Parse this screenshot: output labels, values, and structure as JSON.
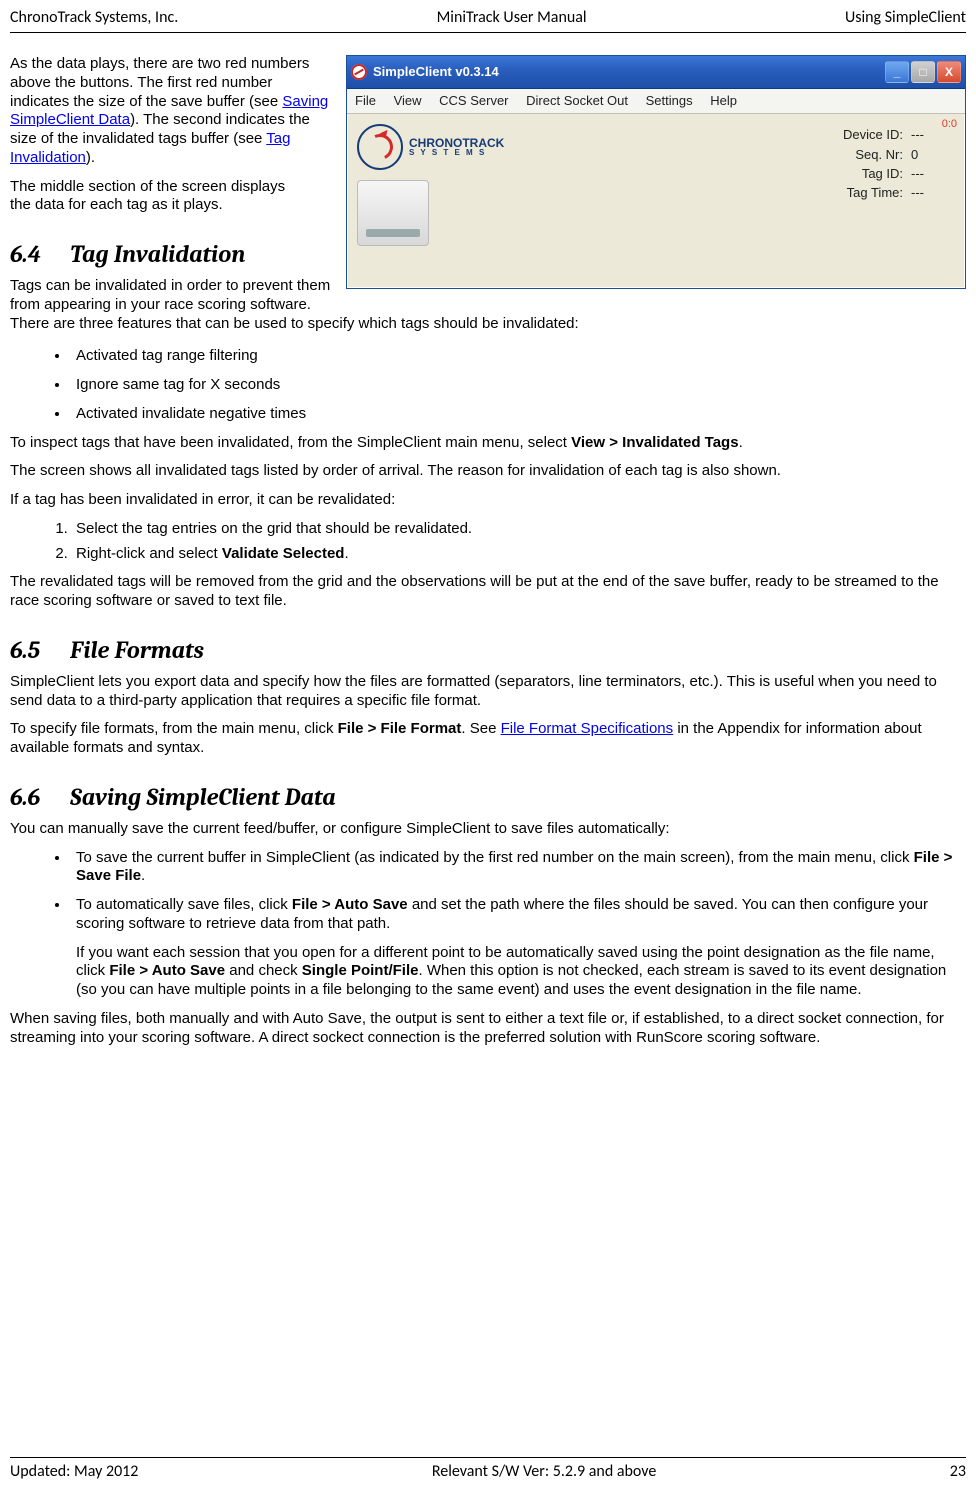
{
  "header": {
    "left": "ChronoTrack Systems, Inc.",
    "center": "MiniTrack User Manual",
    "right": "Using SimpleClient"
  },
  "footer": {
    "left": "Updated: May 2012",
    "center": "Relevant S/W Ver: 5.2.9 and above",
    "right": "23"
  },
  "intro": {
    "p1a": "As the data plays, there are two red numbers above the buttons.  The first red number indicates the size of the save buffer (see ",
    "link1": "Saving SimpleClient Data",
    "p1b": "). The second indicates the size of the invalidated tags buffer (see ",
    "link2": "Tag Invalidation",
    "p1c": ").",
    "p2": "The middle section of the screen displays the data for each tag as it plays."
  },
  "screenshot": {
    "title": "SimpleClient v0.3.14",
    "menu": [
      "File",
      "View",
      "CCS Server",
      "Direct Socket Out",
      "Settings",
      "Help"
    ],
    "brand_line1": "CHRONOTRACK",
    "brand_line2": "S Y S T E M S",
    "counter": "0:0",
    "rows": [
      {
        "k": "Device ID:",
        "v": "---"
      },
      {
        "k": "Seq. Nr:",
        "v": "0"
      },
      {
        "k": "Tag ID:",
        "v": "---"
      },
      {
        "k": "Tag Time:",
        "v": "---"
      }
    ],
    "btn_min": "_",
    "btn_max": "□",
    "btn_close": "X"
  },
  "s64": {
    "num": "6.4",
    "title": "Tag Invalidation",
    "p1": "Tags can be invalidated in order to prevent them from appearing in your race scoring software. There are three features that can be used to specify which tags should be invalidated:",
    "bullets": [
      "Activated tag range filtering",
      "Ignore same tag for X seconds",
      "Activated invalidate negative times"
    ],
    "p2a": "To inspect tags that have been invalidated, from the SimpleClient main menu, select ",
    "p2b": "View > Invalidated Tags",
    "p2c": ".",
    "p3": "The screen shows all invalidated tags listed by order of arrival. The reason for invalidation of each tag is also shown.",
    "p4": "If a tag has been invalidated in error, it can be revalidated:",
    "steps": {
      "s1": "Select the tag entries on the grid that should be revalidated.",
      "s2a": "Right-click and select ",
      "s2b": "Validate Selected",
      "s2c": "."
    },
    "p5": "The revalidated tags will be removed from the grid and the observations will be put at the end of the save buffer, ready to be streamed to the race scoring software or saved to text file."
  },
  "s65": {
    "num": "6.5",
    "title": "File Formats",
    "p1": "SimpleClient lets you export data and specify how the files are formatted (separators, line terminators, etc.). This is useful when you need to send data to a third-party application that requires a specific file format.",
    "p2a": "To specify file formats, from the main menu, click ",
    "p2b": "File > File Format",
    "p2c": ". See ",
    "link": "File Format Specifications",
    "p2d": " in the Appendix for information about available formats and syntax."
  },
  "s66": {
    "num": "6.6",
    "title": "Saving SimpleClient Data",
    "p1": "You can manually save the current feed/buffer, or configure SimpleClient to save files automatically:",
    "b1a": "To save the current buffer in SimpleClient (as indicated by the first red number on the main screen), from the main menu, click ",
    "b1b": "File > Save File",
    "b1c": ".",
    "b2a": "To automatically save files, click ",
    "b2b": "File > Auto Save",
    "b2c": " and set the path where the files should be saved. You can then configure your scoring software to retrieve data from that path.",
    "b2d": "If you want each session that you open for a different point to be automatically saved using the point designation as the file name, click ",
    "b2e": "File > Auto Save",
    "b2f": " and check ",
    "b2g": "Single Point/File",
    "b2h": ". When this option is not checked, each stream is saved to its event designation (so you can have multiple points in a file belonging to the same event) and uses the event designation in the file name.",
    "p2": "When saving files, both manually and with Auto Save, the output is sent to either a text file or, if established, to a direct socket connection, for streaming into your scoring software. A direct sockect connection is the preferred solution with RunScore scoring software."
  }
}
